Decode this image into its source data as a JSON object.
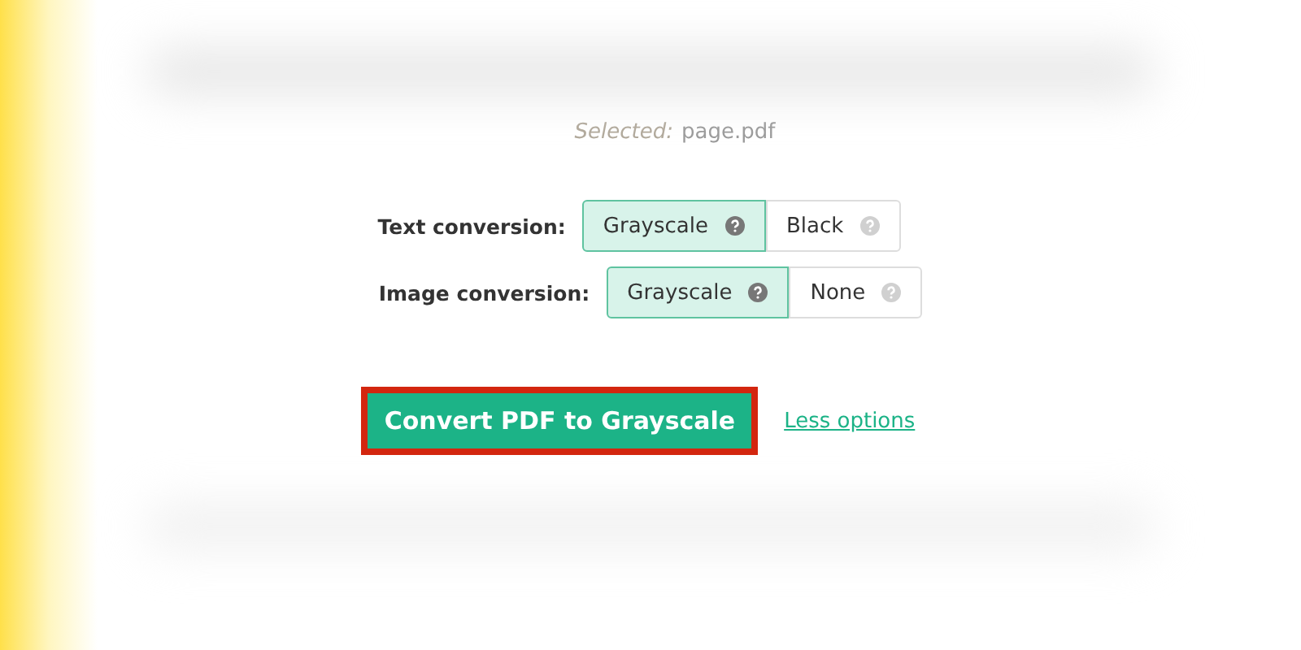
{
  "selected_file": {
    "label": "Selected:",
    "name": "page.pdf"
  },
  "options": [
    {
      "label": "Text conversion:",
      "choices": [
        {
          "label": "Grayscale",
          "selected": true
        },
        {
          "label": "Black",
          "selected": false
        }
      ]
    },
    {
      "label": "Image conversion:",
      "choices": [
        {
          "label": "Grayscale",
          "selected": true
        },
        {
          "label": "None",
          "selected": false
        }
      ]
    }
  ],
  "convert_button": {
    "label": "Convert PDF to Grayscale",
    "highlighted": true
  },
  "options_link": "Less options"
}
